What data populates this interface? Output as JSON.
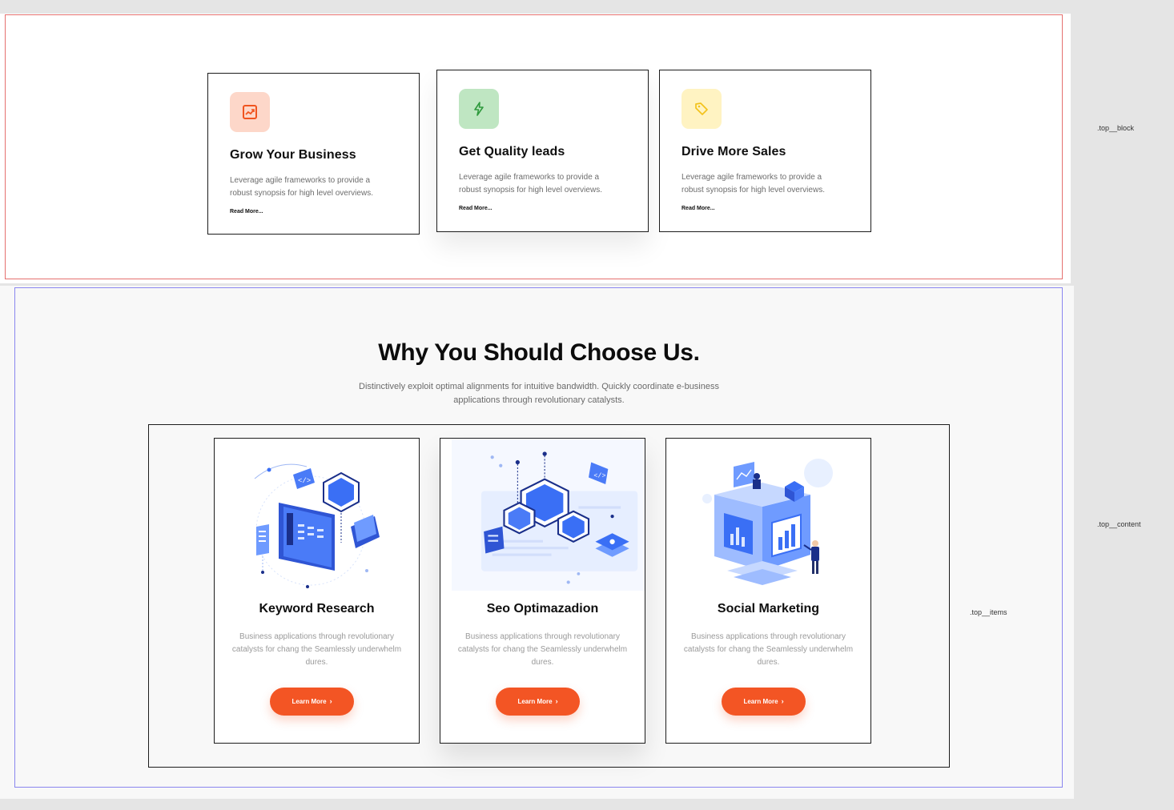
{
  "top_block": {
    "cards": [
      {
        "title": "Grow Your Business",
        "desc": "Leverage agile frameworks to provide a robust synopsis for high level overviews.",
        "link": "Read More...",
        "icon": "chart-up-icon",
        "icon_bg": "#fdd7c9",
        "icon_color": "#f0541f"
      },
      {
        "title": "Get Quality leads",
        "desc": "Leverage agile frameworks to provide a robust synopsis for high level overviews.",
        "link": "Read More...",
        "icon": "lightning-icon",
        "icon_bg": "#bfe6c2",
        "icon_color": "#2f9a3d"
      },
      {
        "title": "Drive More Sales",
        "desc": "Leverage agile frameworks to provide a robust synopsis for high level overviews.",
        "link": "Read More...",
        "icon": "tag-icon",
        "icon_bg": "#fff3c2",
        "icon_color": "#f3c21b"
      }
    ]
  },
  "section": {
    "title": "Why You Should Choose Us.",
    "subtitle": "Distinctively exploit optimal alignments for intuitive bandwidth. Quickly coordinate e-business applications through revolutionary catalysts."
  },
  "services": [
    {
      "title": "Keyword Research",
      "desc": "Business applications through revolutionary catalysts for chang the Seamlessly underwhelm dures.",
      "button": "Learn More"
    },
    {
      "title": "Seo Optimazadion",
      "desc": "Business applications through revolutionary catalysts for chang the Seamlessly underwhelm dures.",
      "button": "Learn More"
    },
    {
      "title": "Social Marketing",
      "desc": "Business applications through revolutionary catalysts for chang the Seamlessly underwhelm dures.",
      "button": "Learn More"
    }
  ],
  "labels": {
    "top_block": ".top__block",
    "top_content": ".top__content",
    "top_items": ".top__items"
  },
  "colors": {
    "accent": "#f35524",
    "illustration_blue": "#3a6ff5"
  }
}
